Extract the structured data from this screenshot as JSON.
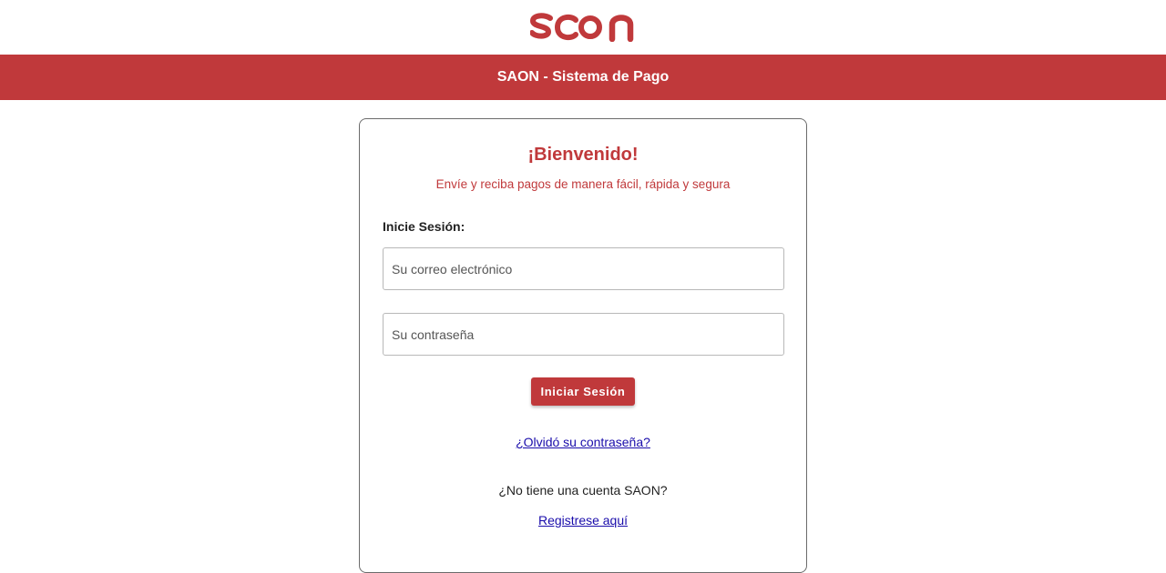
{
  "header": {
    "logo_text": "saon",
    "title": "SAON - Sistema de Pago"
  },
  "login_card": {
    "welcome": "¡Bienvenido!",
    "tagline": "Envíe y reciba pagos de manera fácil, rápida y segura",
    "section_label": "Inicie Sesión:",
    "email_placeholder": "Su correo electrónico",
    "password_placeholder": "Su contraseña",
    "login_button": "Iniciar Sesión",
    "forgot_link": "¿Olvidó su contraseña?",
    "no_account_text": "¿No tiene una cuenta SAON?",
    "register_link": "Registrese aquí"
  },
  "colors": {
    "brand_red": "#c0393b",
    "link_blue": "#1a0dab"
  }
}
